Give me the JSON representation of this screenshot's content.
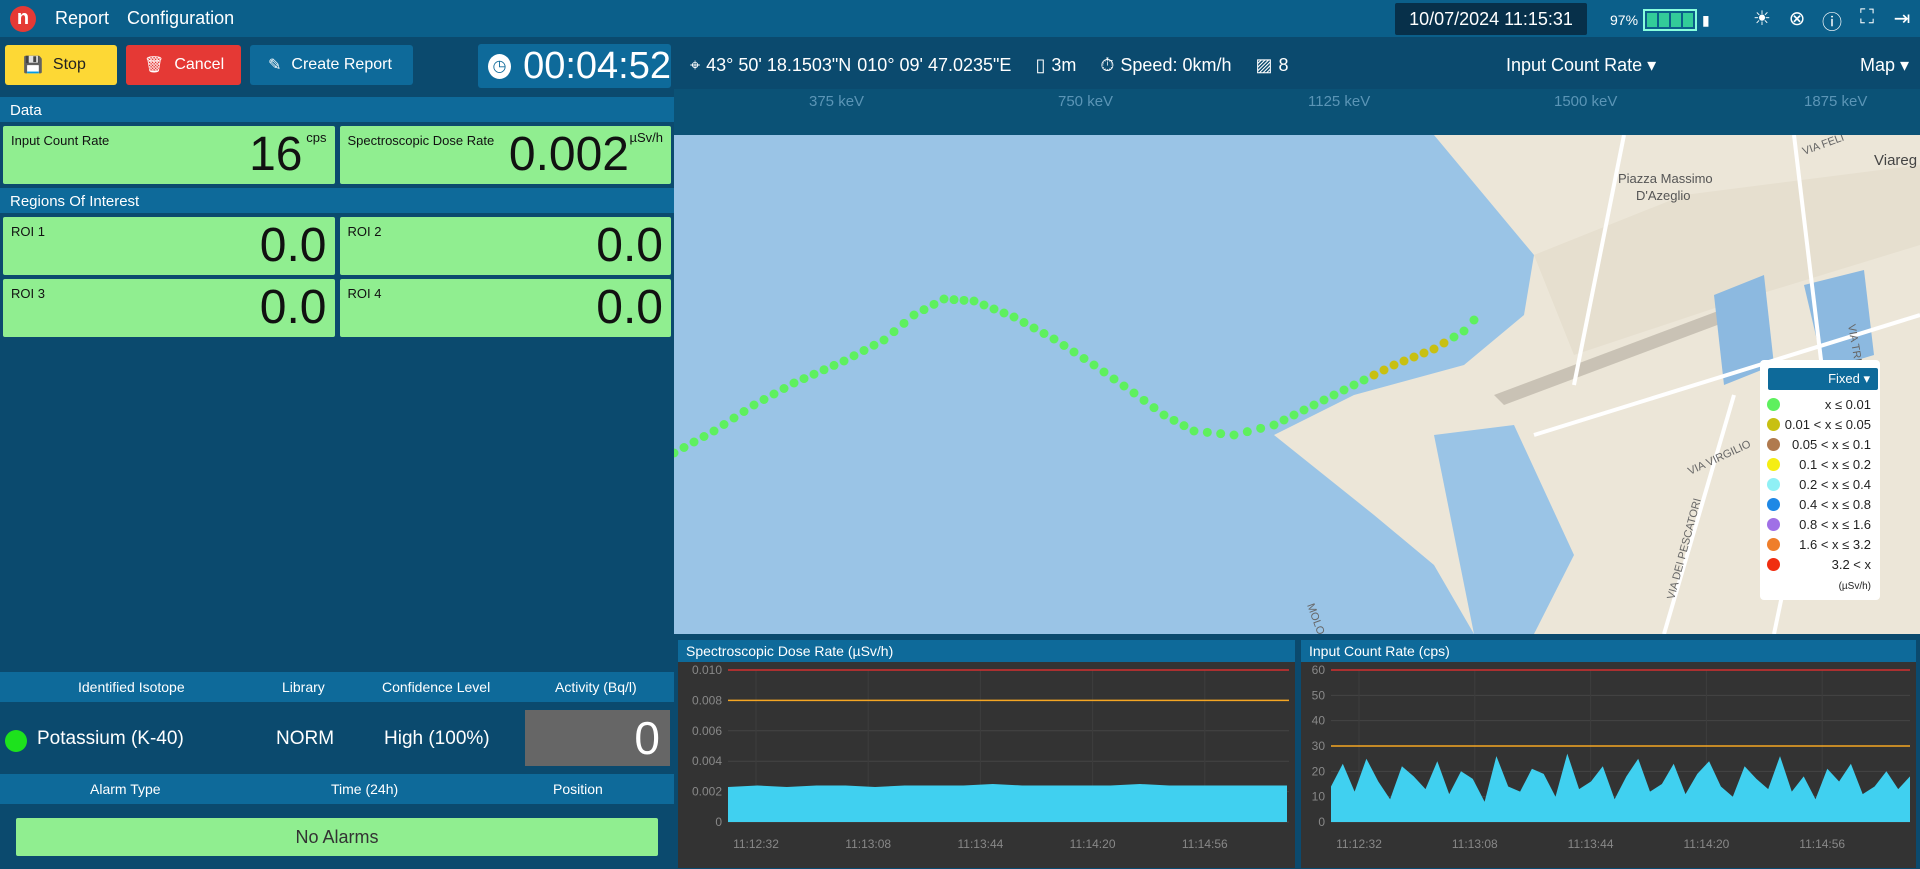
{
  "topbar": {
    "logo": "n",
    "menu": [
      "Report",
      "Configuration"
    ],
    "datetime": "10/07/2024 11:15:31",
    "battery_pct": "97%"
  },
  "toolbar": {
    "stop_label": "Stop",
    "cancel_label": "Cancel",
    "create_report_label": "Create Report",
    "timer": "00:04:52",
    "lat": "43° 50' 18.1503\"N",
    "lon": "010° 09' 47.0235\"E",
    "altitude": "3m",
    "speed": "Speed: 0km/h",
    "photo_count": "8",
    "metric_dropdown": "Input Count Rate",
    "view_dropdown": "Map"
  },
  "data_section": {
    "title": "Data",
    "input_count_rate": {
      "label": "Input Count Rate",
      "value": "16",
      "unit": "cps"
    },
    "dose_rate": {
      "label": "Spectroscopic Dose Rate",
      "value": "0.002",
      "unit": "µSv/h"
    }
  },
  "roi_section": {
    "title": "Regions Of Interest",
    "rois": [
      {
        "label": "ROI 1",
        "value": "0.0"
      },
      {
        "label": "ROI 2",
        "value": "0.0"
      },
      {
        "label": "ROI 3",
        "value": "0.0"
      },
      {
        "label": "ROI 4",
        "value": "0.0"
      }
    ]
  },
  "isotope_table": {
    "headers": [
      "Identified Isotope",
      "Library",
      "Confidence Level",
      "Activity (Bq/l)"
    ],
    "row": {
      "isotope": "Potassium (K-40)",
      "library": "NORM",
      "confidence": "High (100%)",
      "activity": "0"
    }
  },
  "alarm_table": {
    "headers": [
      "Alarm Type",
      "Time (24h)",
      "Position"
    ],
    "empty_text": "No Alarms"
  },
  "spectrum_ticks": [
    "375 keV",
    "750 keV",
    "1125 keV",
    "1500 keV",
    "1875 keV"
  ],
  "map": {
    "labels": [
      "Piazza Massimo",
      "D'Azeglio",
      "Viareg",
      "VIA FELI",
      "VIA VIRGILIO",
      "VIA DEI PESCATORI",
      "MOLO",
      "VIA TRI"
    ],
    "legend": {
      "mode": "Fixed",
      "items": [
        {
          "label": "x ≤ 0.01",
          "color": "#5ef05e"
        },
        {
          "label": "0.01 < x ≤ 0.05",
          "color": "#c8c012"
        },
        {
          "label": "0.05 < x ≤ 0.1",
          "color": "#b07a4e"
        },
        {
          "label": "0.1 < x ≤ 0.2",
          "color": "#f5ee13"
        },
        {
          "label": "0.2 < x ≤ 0.4",
          "color": "#8ff0f5"
        },
        {
          "label": "0.4 < x ≤ 0.8",
          "color": "#1e88e5"
        },
        {
          "label": "0.8 < x ≤ 1.6",
          "color": "#a070e6"
        },
        {
          "label": "1.6 < x ≤ 3.2",
          "color": "#ef7e2b"
        },
        {
          "label": "3.2 < x",
          "color": "#f02e10"
        }
      ],
      "unit": "(µSv/h)"
    }
  },
  "chart_data": [
    {
      "type": "area",
      "title": "Spectroscopic Dose Rate (µSv/h)",
      "yticks": [
        "0.010",
        "0.008",
        "0.006",
        "0.004",
        "0.002",
        "0"
      ],
      "xticks": [
        "11:12:32",
        "11:13:08",
        "11:13:44",
        "11:14:20",
        "11:14:56"
      ],
      "ylim": [
        0,
        0.01
      ],
      "thresholds": [
        {
          "value": 0.01,
          "color": "#d32f2f"
        },
        {
          "value": 0.008,
          "color": "#f5a623"
        }
      ],
      "series": [
        {
          "values": [
            0.0023,
            0.0024,
            0.0023,
            0.0024,
            0.0024,
            0.0023,
            0.0024,
            0.0024,
            0.0024,
            0.0025,
            0.0024,
            0.0024,
            0.0024,
            0.0024,
            0.0025,
            0.0024,
            0.0024,
            0.0024,
            0.0024,
            0.0024
          ]
        }
      ]
    },
    {
      "type": "area",
      "title": "Input Count Rate (cps)",
      "yticks": [
        "60",
        "50",
        "40",
        "30",
        "20",
        "10",
        "0"
      ],
      "xticks": [
        "11:12:32",
        "11:13:08",
        "11:13:44",
        "11:14:20",
        "11:14:56"
      ],
      "ylim": [
        0,
        60
      ],
      "thresholds": [
        {
          "value": 60,
          "color": "#d32f2f"
        },
        {
          "value": 30,
          "color": "#f5a623"
        }
      ],
      "series": [
        {
          "values": [
            14,
            23,
            12,
            25,
            16,
            9,
            22,
            18,
            13,
            24,
            11,
            20,
            17,
            8,
            26,
            14,
            12,
            21,
            19,
            10,
            27,
            13,
            16,
            22,
            9,
            18,
            25,
            12,
            15,
            23,
            11,
            19,
            24,
            14,
            10,
            22,
            17,
            13,
            26,
            12,
            18,
            9,
            21,
            16,
            23,
            11,
            14,
            20,
            13,
            18
          ]
        }
      ]
    }
  ]
}
